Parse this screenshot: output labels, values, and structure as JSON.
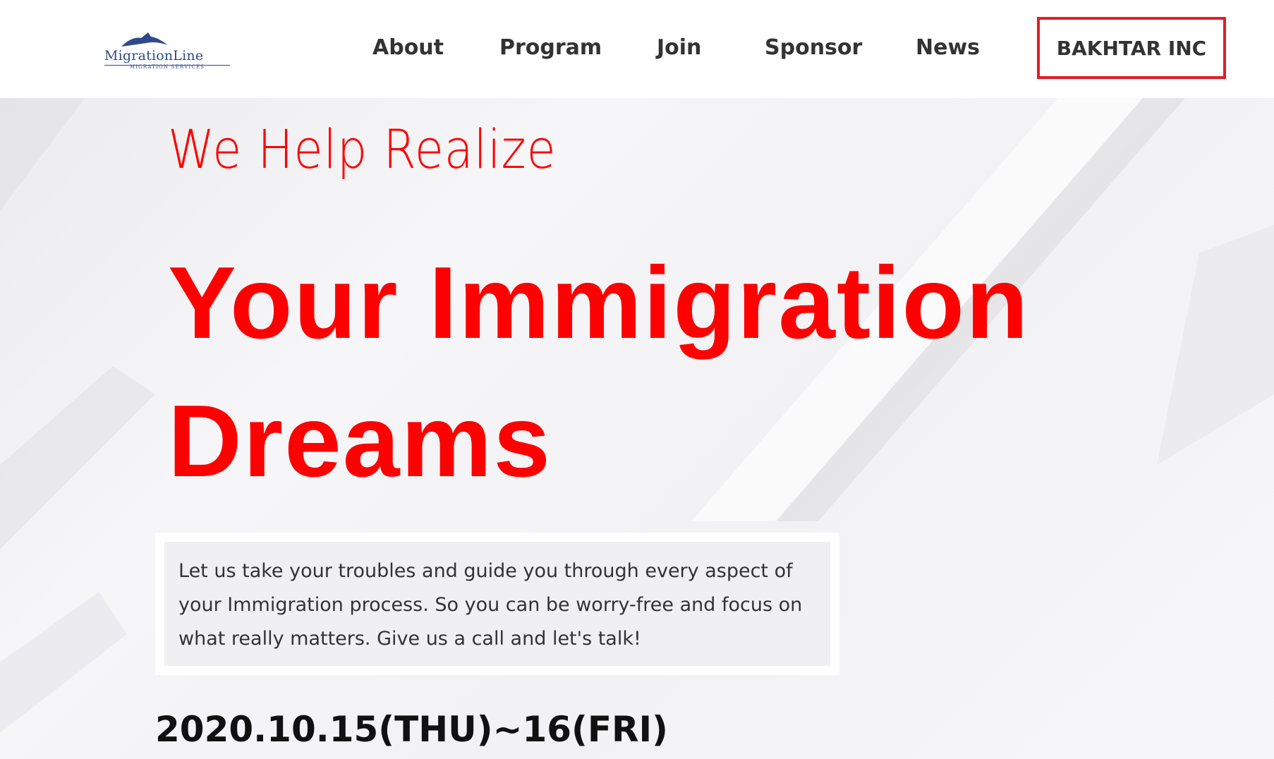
{
  "header": {
    "logo": {
      "name": "MigrationLine",
      "tagline": "MIGRATION SERVICES",
      "icon": "bird-icon",
      "color": "#2e4a8c"
    },
    "nav": [
      {
        "label": "About"
      },
      {
        "label": "Program"
      },
      {
        "label": "Join"
      },
      {
        "label": "Sponsor"
      },
      {
        "label": "News"
      }
    ],
    "company_label": "BAKHTAR INC",
    "company_border_color": "#e31e24"
  },
  "hero": {
    "kicker": "We Help Realize",
    "title": "Your Immigration Dreams",
    "description": "Let us take your troubles and guide you through every aspect of your Immigration process. So you can be worry-free and focus on what really matters. Give us a call and let's talk!",
    "date": "2020.10.15(THU)~16(FRI)",
    "accent_color": "#ff0000"
  }
}
